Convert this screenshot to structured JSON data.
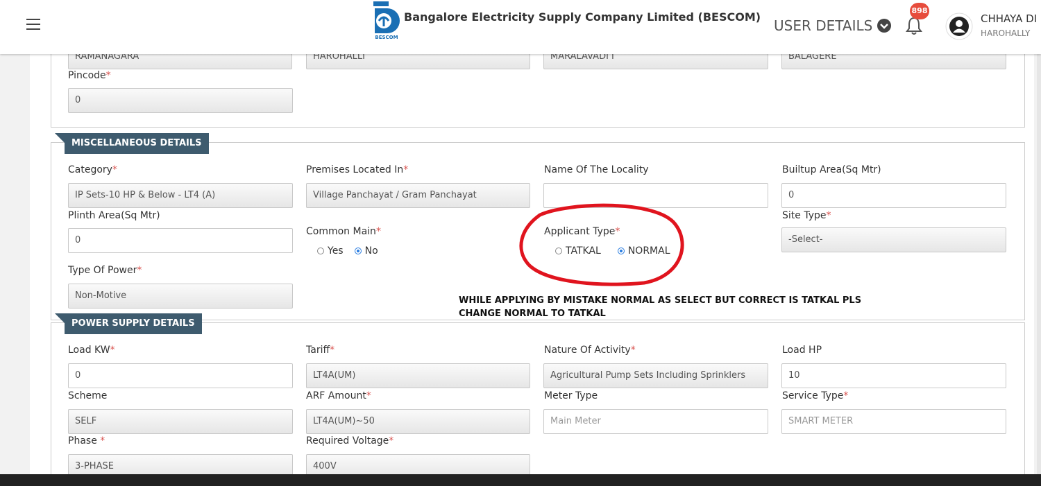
{
  "header": {
    "title": "Bangalore Electricity Supply Company Limited (BESCOM)",
    "logo_text": "BESCOM",
    "user_details_label": "USER DETAILS",
    "notification_count": "898",
    "user_name": "CHHAYA DI",
    "user_location": "HAROHALLY"
  },
  "address": {
    "fields": [
      "RAMANAGARA",
      "HAROHALLI",
      "MARALAVADI I",
      "BALAGERE"
    ],
    "pincode_label": "Pincode",
    "pincode_value": "0"
  },
  "misc": {
    "title": "MISCELLANEOUS DETAILS",
    "category_label": "Category",
    "category_value": "IP Sets-10 HP & Below - LT4 (A)",
    "premises_label": "Premises Located In",
    "premises_value": "Village Panchayat / Gram Panchayat",
    "locality_label": "Name Of The Locality",
    "locality_value": "",
    "builtup_label": "Builtup Area(Sq Mtr)",
    "builtup_value": "0",
    "plinth_label": "Plinth Area(Sq Mtr)",
    "plinth_value": "0",
    "common_main_label": "Common Main",
    "common_main_options": [
      "Yes",
      "No"
    ],
    "common_main_selected": "No",
    "applicant_type_label": "Applicant Type",
    "applicant_type_options": [
      "TATKAL",
      "NORMAL"
    ],
    "applicant_type_selected": "NORMAL",
    "site_type_label": "Site Type",
    "site_type_value": "-Select-",
    "power_type_label": "Type Of Power",
    "power_type_value": "Non-Motive"
  },
  "annotation": {
    "text": "WHILE APPLYING BY MISTAKE NORMAL AS SELECT BUT CORRECT IS TATKAL PLS CHANGE NORMAL TO TATKAL",
    "circle_color": "#e0141e"
  },
  "power": {
    "title": "POWER SUPPLY DETAILS",
    "load_kw_label": "Load KW",
    "load_kw_value": "0",
    "tariff_label": "Tariff",
    "tariff_value": "LT4A(UM)",
    "activity_label": "Nature Of Activity",
    "activity_value": "Agricultural Pump Sets Including Sprinklers",
    "load_hp_label": "Load HP",
    "load_hp_value": "10",
    "scheme_label": "Scheme",
    "scheme_value": "SELF",
    "arf_label": "ARF Amount",
    "arf_value": "LT4A(UM)~50",
    "meter_label": "Meter Type",
    "meter_value": "Main Meter",
    "service_label": "Service Type",
    "service_value": "SMART METER",
    "phase_label": "Phase ",
    "phase_value": "3-PHASE",
    "voltage_label": "Required Voltage",
    "voltage_value": "400V"
  },
  "colors": {
    "section_header": "#3e5b6e",
    "required_star": "#d9534f",
    "radio_selected": "#2a7de1",
    "badge": "#e74c3c"
  }
}
